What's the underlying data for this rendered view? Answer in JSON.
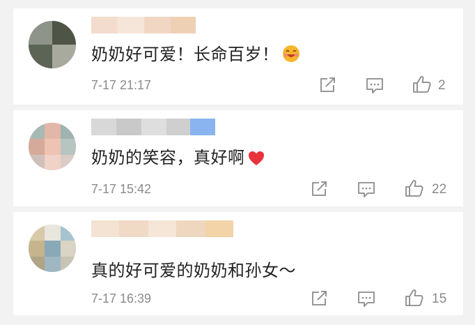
{
  "comments": [
    {
      "text": "奶奶好可爱！长命百岁！",
      "emoji": "laughing-face-emoji",
      "time": "7-17 21:17",
      "likes": "2"
    },
    {
      "text": "奶奶的笑容，真好啊",
      "emoji": "red-heart-emoji",
      "time": "7-17 15:42",
      "likes": "22"
    },
    {
      "text": "真的好可爱的奶奶和孙女～",
      "emoji": "",
      "time": "7-17 16:39",
      "likes": "15"
    }
  ],
  "colors": {
    "background": "#f2f2f2",
    "card": "#ffffff",
    "text": "#222222",
    "meta": "#8a8a8a",
    "heart": "#e8323c",
    "emoji": "#f5a524"
  }
}
